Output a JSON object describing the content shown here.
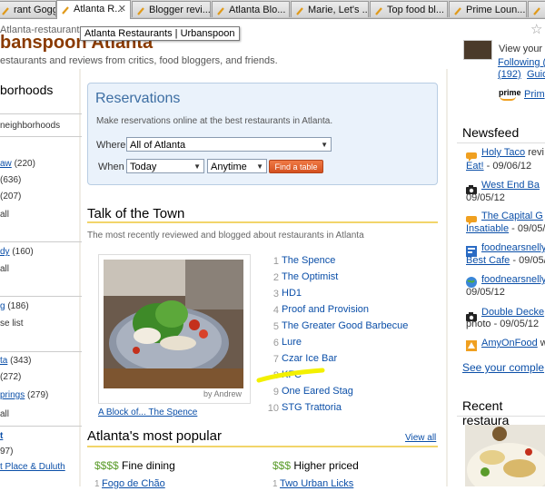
{
  "browser": {
    "tabs": [
      {
        "label": "rant Gogg...",
        "active": false
      },
      {
        "label": "Atlanta R...",
        "active": true
      },
      {
        "label": "Blogger revi...",
        "active": false
      },
      {
        "label": "Atlanta Blo...",
        "active": false
      },
      {
        "label": "Marie, Let's ...",
        "active": false
      },
      {
        "label": "Top food bl...",
        "active": false
      },
      {
        "label": "Prime Loun...",
        "active": false
      },
      {
        "label": "P",
        "active": false
      }
    ],
    "address_text": "Atlanta-restaurants",
    "tooltip": "Atlanta Restaurants | Urbanspoon"
  },
  "header": {
    "logo_partial": "banspoon Atlanta",
    "tagline": "estaurants and reviews from critics, food bloggers, and friends."
  },
  "left": {
    "heading": "borhoods",
    "items": [
      {
        "link": "",
        "text": "neighborhoods"
      },
      {
        "link": "aw",
        "text": " (220)"
      },
      {
        "link": "",
        "text": "(636)"
      },
      {
        "link": "",
        "text": "(207)"
      },
      {
        "link": "",
        "text": "all"
      },
      {
        "link": "dy",
        "text": " (160)"
      },
      {
        "link": "",
        "text": "all"
      },
      {
        "link": "g",
        "text": " (186)"
      },
      {
        "link": "",
        "text": "se list"
      },
      {
        "link": "ta",
        "text": " (343)"
      },
      {
        "link": "",
        "text": "(272)"
      },
      {
        "link": "prings",
        "text": " (279)"
      },
      {
        "link": "",
        "text": "all"
      },
      {
        "link": "t",
        "text": ""
      },
      {
        "link": "",
        "text": "97)"
      },
      {
        "link": "t Place & Duluth",
        "text": ""
      }
    ]
  },
  "reservations": {
    "title": "Reservations",
    "description": "Make reservations online at the best restaurants in Atlanta.",
    "where_label": "Where",
    "where_value": "All of Atlanta",
    "when_label": "When",
    "day_value": "Today",
    "time_value": "Anytime",
    "find_button": "Find a table"
  },
  "talk_of_town": {
    "title": "Talk of the Town",
    "description": "The most recently reviewed and blogged about restaurants in Atlanta",
    "photo_credit": "by Andrew",
    "photo_caption": "A Block of... The Spence",
    "list": [
      {
        "rank": "1",
        "name": "The Spence"
      },
      {
        "rank": "2",
        "name": "The Optimist"
      },
      {
        "rank": "3",
        "name": "HD1"
      },
      {
        "rank": "4",
        "name": "Proof and Provision"
      },
      {
        "rank": "5",
        "name": "The Greater Good Barbecue"
      },
      {
        "rank": "6",
        "name": "Lure"
      },
      {
        "rank": "7",
        "name": "Czar Ice Bar"
      },
      {
        "rank": "8",
        "name": "KFC"
      },
      {
        "rank": "9",
        "name": "One Eared Stag"
      },
      {
        "rank": "10",
        "name": "STG Trattoria"
      }
    ]
  },
  "popular": {
    "title": "Atlanta's most popular",
    "view_all": "View all",
    "col1_dollars": "$$$$",
    "col1_label": "Fine dining",
    "col2_dollars": "$$$",
    "col2_label": "Higher priced",
    "col1_num": "1",
    "col1_item": "Fogo de Chão",
    "col2_num": "1",
    "col2_item": "Two Urban Licks"
  },
  "right": {
    "view_prefix": "View your p",
    "following_link": "Following (",
    "count_link": "(192)",
    "guide_link": "Guid",
    "prime_logo": "prime",
    "prime_link": "Prim",
    "newsfeed_title": "Newsfeed",
    "feed": [
      {
        "line1_link": "Holy Taco",
        "line1_text": " revi",
        "line2_link": "Eat!",
        "line2_text": " - 09/06/12"
      },
      {
        "line1_link": "West End Ba",
        "line1_text": "",
        "line2_link": "",
        "line2_text": "09/05/12"
      },
      {
        "line1_link": "The Capital G",
        "line1_text": "",
        "line2_link": "Insatiable",
        "line2_text": " - 09/05/12"
      },
      {
        "line1_link": "foodnearsnelly",
        "line1_text": "",
        "line2_link": "Best Cafe",
        "line2_text": " - 09/05/12"
      },
      {
        "line1_link": "foodnearsnelly",
        "line1_text": "",
        "line2_link": "",
        "line2_text": "09/05/12"
      },
      {
        "line1_link": "Double Decke",
        "line1_text": "",
        "line2_link": "",
        "line2_text": "photo - 09/05/12"
      },
      {
        "line1_link": "AmyOnFood",
        "line1_text": " w",
        "line2_link": "",
        "line2_text": ""
      }
    ],
    "see_all": "See your comple",
    "recent_title": "Recent restaura"
  },
  "colors": {
    "link": "#0b4fa8",
    "accent_yellow": "#f2d56a",
    "button_orange": "#e0602c",
    "resv_bg": "#eaf2fb",
    "highlighter": "#f3f000"
  }
}
